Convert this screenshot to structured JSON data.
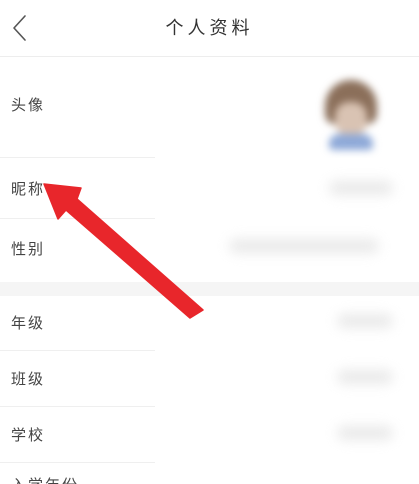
{
  "header": {
    "title": "个人资料",
    "back_icon": "chevron-left-icon"
  },
  "profile": {
    "avatar_label": "头像",
    "nickname_label": "昵称",
    "gender_label": "性别",
    "grade_label": "年级",
    "class_label": "班级",
    "school_label": "学校",
    "partial_label": "入学年份"
  },
  "annotation": {
    "arrow_color": "#e8262b",
    "arrow_icon": "red-arrow-pointer"
  },
  "colors": {
    "background": "#ffffff",
    "section_gap": "#f5f5f5",
    "label_text": "#444444",
    "title_text": "#333333"
  }
}
